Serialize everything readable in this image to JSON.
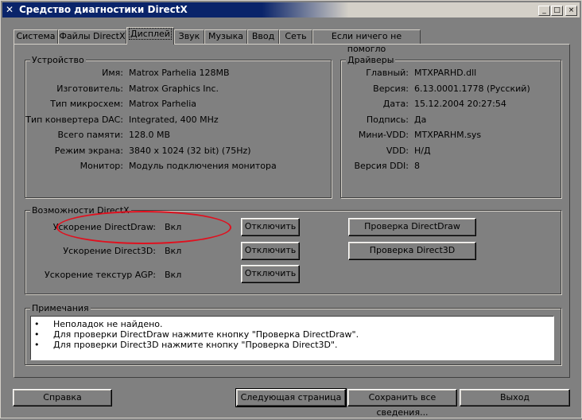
{
  "window": {
    "title": "Средство диагностики DirectX"
  },
  "title_buttons": {
    "minimize": "_",
    "maximize": "□",
    "close": "×"
  },
  "tabs": [
    {
      "label": "Система"
    },
    {
      "label": "Файлы DirectX"
    },
    {
      "label": "Дисплей"
    },
    {
      "label": "Звук"
    },
    {
      "label": "Музыка"
    },
    {
      "label": "Ввод"
    },
    {
      "label": "Сеть"
    },
    {
      "label": "Если ничего не помогло"
    }
  ],
  "device": {
    "title": "Устройство",
    "rows": [
      {
        "label": "Имя:",
        "value": "Matrox Parhelia 128MB"
      },
      {
        "label": "Изготовитель:",
        "value": "Matrox Graphics Inc."
      },
      {
        "label": "Тип микросхем:",
        "value": "Matrox Parhelia"
      },
      {
        "label": "Тип конвертера DAC:",
        "value": "Integrated, 400 MHz"
      },
      {
        "label": "Всего памяти:",
        "value": "128.0 MB"
      },
      {
        "label": "Режим экрана:",
        "value": "3840 x 1024 (32 bit) (75Hz)"
      },
      {
        "label": "Монитор:",
        "value": "Модуль подключения монитора"
      }
    ]
  },
  "drivers": {
    "title": "Драйверы",
    "rows": [
      {
        "label": "Главный:",
        "value": "MTXPARHD.dll"
      },
      {
        "label": "Версия:",
        "value": "6.13.0001.1778 (Русский)"
      },
      {
        "label": "Дата:",
        "value": "15.12.2004 20:27:54"
      },
      {
        "label": "Подпись:",
        "value": "Да"
      },
      {
        "label": "Мини-VDD:",
        "value": "MTXPARHM.sys"
      },
      {
        "label": "VDD:",
        "value": "Н/Д"
      },
      {
        "label": "Версия DDI:",
        "value": "8"
      }
    ]
  },
  "features": {
    "title": "Возможности DirectX",
    "rows": [
      {
        "label": "Ускорение DirectDraw:",
        "value": "Вкл",
        "button": "Отключить"
      },
      {
        "label": "Ускорение Direct3D:",
        "value": "Вкл",
        "button": "Отключить"
      },
      {
        "label": "Ускорение текстур AGP:",
        "value": "Вкл",
        "button": "Отключить"
      }
    ],
    "test_directdraw": "Проверка DirectDraw",
    "test_direct3d": "Проверка Direct3D",
    "highlight_color": "#e0101e"
  },
  "notes": {
    "title": "Примечания",
    "items": [
      "Неполадок не найдено.",
      "Для проверки DirectDraw нажмите кнопку \"Проверка DirectDraw\".",
      "Для проверки Direct3D нажмите кнопку \"Проверка Direct3D\"."
    ]
  },
  "bottom_buttons": {
    "help": "Справка",
    "next_page": "Следующая страница",
    "save_all": "Сохранить все сведения...",
    "exit": "Выход"
  }
}
